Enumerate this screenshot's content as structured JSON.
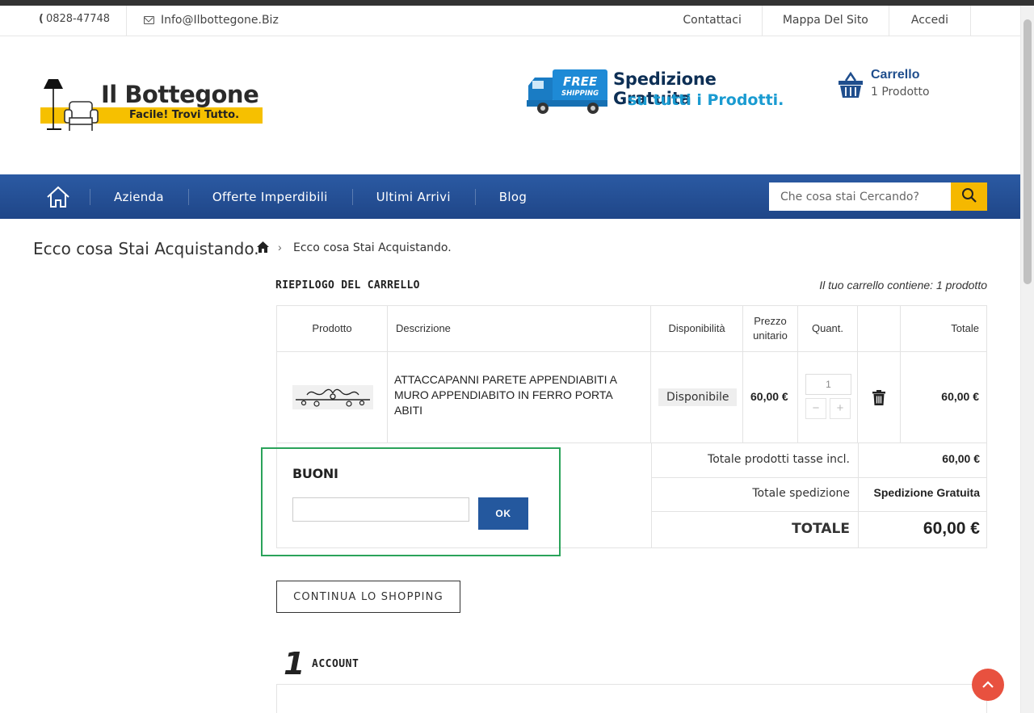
{
  "topbar": {
    "phone": "0828-47748",
    "email": "Info@Ilbottegone.Biz",
    "links": [
      "Contattaci",
      "Mappa Del Sito",
      "Accedi"
    ]
  },
  "header": {
    "logo_title": "Il Bottegone",
    "logo_tagline": "Facile! Trovi Tutto.",
    "shipping_badge": "FREE",
    "shipping_badge_sub": "SHIPPING",
    "shipping_line1": "Spedizione Gratuita",
    "shipping_line2": "su tutti i Prodotti.",
    "cart_title": "Carrello",
    "cart_count": "1 Prodotto"
  },
  "nav": {
    "items": [
      "Azienda",
      "Offerte Imperdibili",
      "Ultimi Arrivi",
      "Blog"
    ],
    "search_placeholder": "Che cosa stai Cercando?"
  },
  "breadcrumb": {
    "page_title": "Ecco cosa Stai Acquistando.",
    "separator": "›",
    "current": "Ecco cosa Stai Acquistando."
  },
  "summary": {
    "title": "RIEPILOGO DEL CARRELLO",
    "count": "Il tuo carrello contiene: 1 prodotto",
    "headers": {
      "product": "Prodotto",
      "description": "Descrizione",
      "availability": "Disponibilità",
      "unit_price_1": "Prezzo",
      "unit_price_2": "unitario",
      "quantity": "Quant.",
      "total": "Totale"
    },
    "item": {
      "description": "ATTACCAPANNI PARETE APPENDIABITI A MURO APPENDIABITO IN FERRO PORTA ABITI",
      "availability": "Disponibile",
      "unit_price": "60,00 €",
      "quantity": "1",
      "minus": "−",
      "plus": "+",
      "total": "60,00 €"
    },
    "totals": {
      "products_label": "Totale prodotti tasse incl.",
      "products_value": "60,00 €",
      "shipping_label": "Totale spedizione",
      "shipping_value": "Spedizione Gratuita",
      "grand_label": "TOTALE",
      "grand_value": "60,00 €"
    }
  },
  "vouchers": {
    "title": "BUONI",
    "input_value": "",
    "ok_label": "OK"
  },
  "continue_label": "CONTINUA LO SHOPPING",
  "step": {
    "number": "1",
    "title": "ACCOUNT"
  },
  "colors": {
    "nav_blue": "#24589e",
    "accent_yellow": "#f5b800",
    "cart_blue": "#1f4e8d",
    "highlight_green": "#2aa35a",
    "back_to_top": "#e8513f"
  }
}
